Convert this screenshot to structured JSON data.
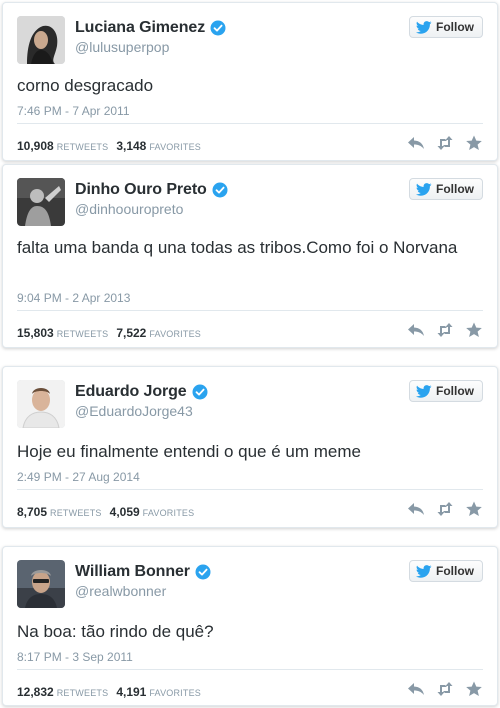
{
  "colors": {
    "verified": "#2aa3ef",
    "follow_bird": "#2aa3ef",
    "muted": "#8899a6",
    "action_icon": "#8899a6"
  },
  "follow_label": "Follow",
  "retweets_label": "RETWEETS",
  "favorites_label": "FAVORITES",
  "tweets": [
    {
      "name": "Luciana Gimenez",
      "handle": "@lulusuperpop",
      "text": "corno desgracado",
      "time": "7:46 PM - 7 Apr 2011",
      "retweets": "10,908",
      "favorites": "3,148"
    },
    {
      "name": "Dinho Ouro Preto",
      "handle": "@dinhoouropreto",
      "text": "falta uma banda q una todas as tribos.Como foi o Norvana",
      "time": "9:04 PM - 2 Apr 2013",
      "retweets": "15,803",
      "favorites": "7,522"
    },
    {
      "name": "Eduardo Jorge",
      "handle": "@EduardoJorge43",
      "text": "Hoje eu finalmente entendi o que é um meme",
      "time": "2:49 PM - 27 Aug 2014",
      "retweets": "8,705",
      "favorites": "4,059"
    },
    {
      "name": "William Bonner",
      "handle": "@realwbonner",
      "text": "Na boa: tão rindo de quê?",
      "time": "8:17 PM - 3 Sep 2011",
      "retweets": "12,832",
      "favorites": "4,191"
    }
  ]
}
